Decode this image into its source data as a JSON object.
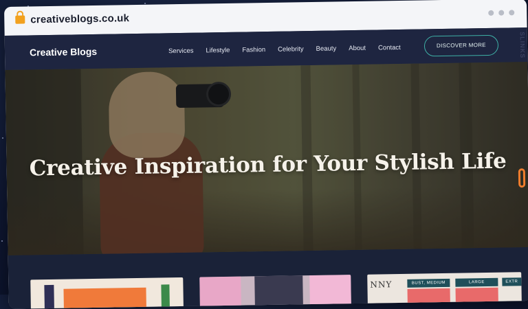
{
  "browser": {
    "url": "creativeblogs.co.uk"
  },
  "site": {
    "brand": "Creative Blogs",
    "menu": [
      "Services",
      "Lifestyle",
      "Fashion",
      "Celebrity",
      "Beauty",
      "About",
      "Contact"
    ],
    "cta_label": "DISCOVER MORE",
    "side_label": "SLINKS"
  },
  "hero": {
    "title": "Creative Inspiration for Your Stylish Life"
  },
  "cards": {
    "card3_tags": [
      "BUST, MEDIUM",
      "LARGE",
      "EXTR"
    ],
    "card3_text": "NNY"
  },
  "colors": {
    "accent_teal": "#3fb3a8",
    "link_orange": "#f07d2d",
    "lock_gold": "#f2a11f",
    "nav_bg": "#1e2540"
  }
}
